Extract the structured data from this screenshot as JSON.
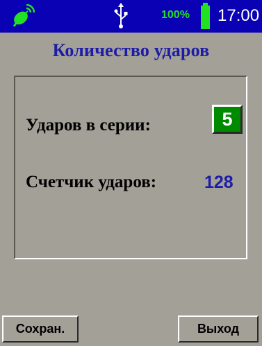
{
  "status_bar": {
    "signal_icon": "satellite-dish-icon",
    "usb_icon": "usb-icon",
    "battery_percent": "100%",
    "battery_level": 1.0,
    "time": "17:00",
    "colors": {
      "background": "#0a00b4",
      "battery": "#22e022",
      "time": "#ffffff"
    }
  },
  "title": "Количество ударов",
  "fields": {
    "shots_label": "Ударов в серии:",
    "shots_value": "5",
    "counter_label": "Счетчик ударов:",
    "counter_value": "128"
  },
  "buttons": {
    "save": "Сохран.",
    "exit": "Выход"
  },
  "colors": {
    "screen_background": "#a3a097",
    "title": "#1c1ca6",
    "value_box": "#008a00"
  }
}
